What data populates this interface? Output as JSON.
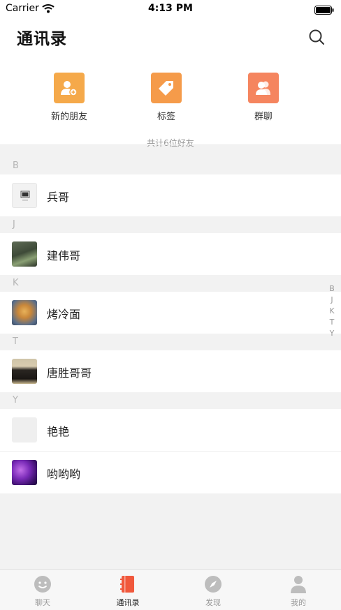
{
  "status_bar": {
    "carrier": "Carrier",
    "time": "4:13 PM"
  },
  "header": {
    "title": "通讯录",
    "search_icon": "search-icon"
  },
  "quick_actions": [
    {
      "label": "新的朋友",
      "icon": "add-friend-icon",
      "color": "#f5a94a"
    },
    {
      "label": "标签",
      "icon": "tag-icon",
      "color": "#f59b4a"
    },
    {
      "label": "群聊",
      "icon": "group-chat-icon",
      "color": "#f5855f"
    }
  ],
  "friend_count": "共计6位好友",
  "sections": [
    {
      "letter": "B",
      "contacts": [
        {
          "name": "兵哥",
          "avatar": "placeholder-image-avatar"
        }
      ]
    },
    {
      "letter": "J",
      "contacts": [
        {
          "name": "建伟哥",
          "avatar": "photo-avatar"
        }
      ]
    },
    {
      "letter": "K",
      "contacts": [
        {
          "name": "烤冷面",
          "avatar": "food-photo-avatar"
        }
      ]
    },
    {
      "letter": "T",
      "contacts": [
        {
          "name": "唐胜哥哥",
          "avatar": "photo-avatar"
        }
      ]
    },
    {
      "letter": "Y",
      "contacts": [
        {
          "name": "艳艳",
          "avatar": "blank-avatar"
        },
        {
          "name": "哟哟哟",
          "avatar": "purple-photo-avatar"
        }
      ]
    }
  ],
  "index_letters": [
    "B",
    "J",
    "K",
    "T",
    "Y"
  ],
  "tab_bar": {
    "active": "通讯录",
    "tabs": [
      {
        "label": "聊天",
        "icon": "chat-icon"
      },
      {
        "label": "通讯录",
        "icon": "contacts-book-icon"
      },
      {
        "label": "发现",
        "icon": "compass-icon"
      },
      {
        "label": "我的",
        "icon": "profile-icon"
      }
    ]
  },
  "colors": {
    "accent": "#f0583c",
    "inactive_icon": "#bdbdbd"
  }
}
